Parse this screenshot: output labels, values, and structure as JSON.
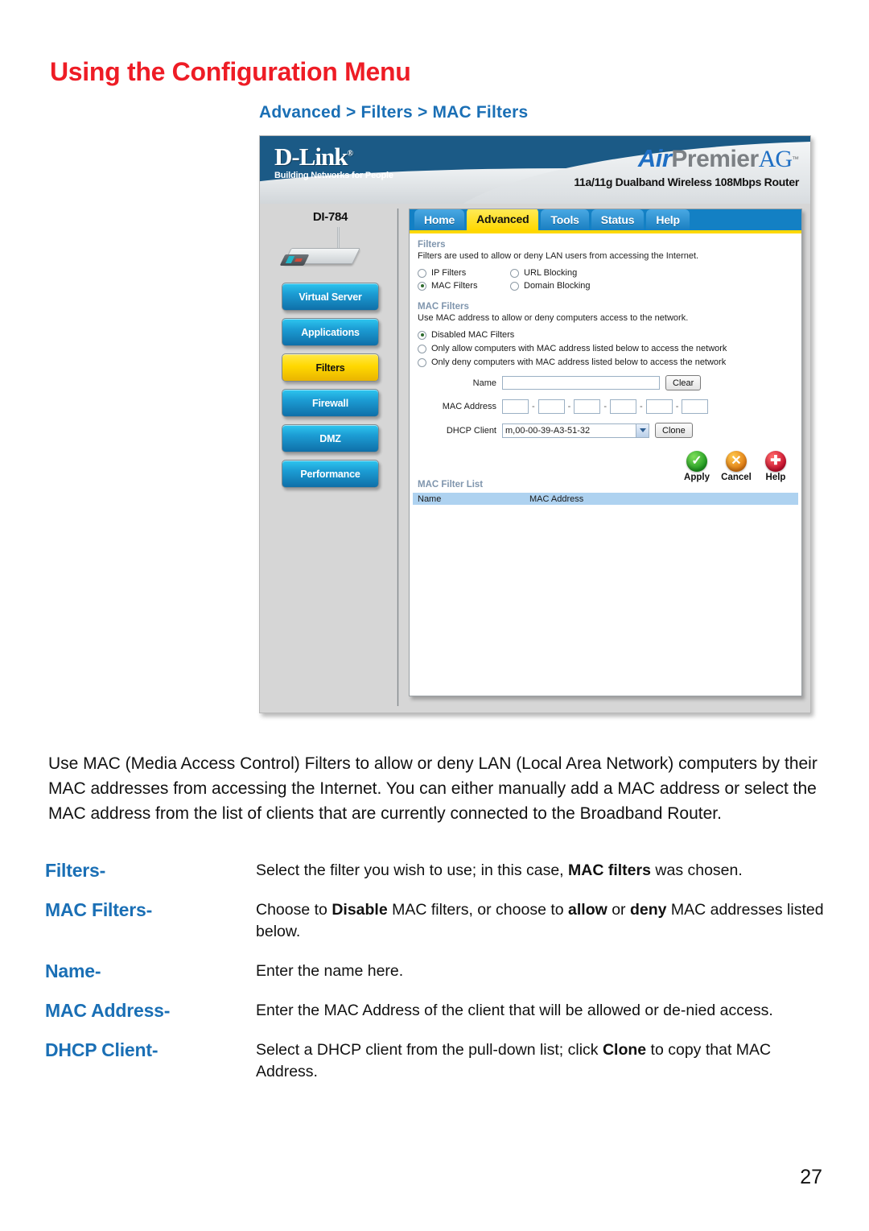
{
  "page": {
    "title": "Using the Configuration Menu",
    "breadcrumb": "Advanced > Filters > MAC Filters",
    "number": "27",
    "title_color": "#ee1c25",
    "accent_color": "#1a6fb5"
  },
  "router_ui": {
    "brand": {
      "name": "D-Link",
      "registered": "®",
      "tagline": "Building Networks for People",
      "product_air": "Air",
      "product_premier": "Premier",
      "product_ag": "AG",
      "trademark": "™",
      "subtitle": "11a/11g Dualband Wireless 108Mbps Router"
    },
    "model": "DI-784",
    "tabs": [
      {
        "label": "Home",
        "active": false
      },
      {
        "label": "Advanced",
        "active": true
      },
      {
        "label": "Tools",
        "active": false
      },
      {
        "label": "Status",
        "active": false
      },
      {
        "label": "Help",
        "active": false
      }
    ],
    "sidebar": [
      {
        "label": "Virtual Server",
        "active": false
      },
      {
        "label": "Applications",
        "active": false
      },
      {
        "label": "Filters",
        "active": true
      },
      {
        "label": "Firewall",
        "active": false
      },
      {
        "label": "DMZ",
        "active": false
      },
      {
        "label": "Performance",
        "active": false
      }
    ],
    "filters_section": {
      "title": "Filters",
      "description": "Filters are used to allow or deny LAN users from accessing the Internet.",
      "options_left": [
        {
          "label": "IP Filters",
          "selected": false
        },
        {
          "label": "MAC Filters",
          "selected": true
        }
      ],
      "options_right": [
        {
          "label": "URL Blocking",
          "selected": false
        },
        {
          "label": "Domain Blocking",
          "selected": false
        }
      ]
    },
    "mac_filters_section": {
      "title": "MAC Filters",
      "description": "Use MAC address to allow or deny computers access to the network.",
      "modes": [
        {
          "label": "Disabled MAC Filters",
          "selected": true
        },
        {
          "label": "Only allow computers with MAC address listed below to access the network",
          "selected": false
        },
        {
          "label": "Only deny computers with MAC address listed below to access the network",
          "selected": false
        }
      ],
      "name_label": "Name",
      "name_value": "",
      "clear_button": "Clear",
      "mac_label": "MAC Address",
      "mac_octets": [
        "",
        "",
        "",
        "",
        "",
        ""
      ],
      "mac_separator": "-",
      "dhcp_label": "DHCP Client",
      "dhcp_value": "m,00-00-39-A3-51-32",
      "clone_button": "Clone"
    },
    "actions": [
      {
        "label": "Apply",
        "icon": "check-circle-icon",
        "glyph": "✓"
      },
      {
        "label": "Cancel",
        "icon": "cross-circle-icon",
        "glyph": "✕"
      },
      {
        "label": "Help",
        "icon": "plus-circle-icon",
        "glyph": "✚"
      }
    ],
    "filter_list": {
      "title": "MAC Filter List",
      "columns": [
        "Name",
        "MAC Address"
      ],
      "rows": []
    }
  },
  "body": {
    "paragraph": "Use MAC (Media Access Control) Filters to allow or deny LAN (Local Area Network) computers by their MAC addresses from accessing the Internet. You can either manually add a MAC address or select the MAC address from the list of clients that are currently connected to the Broadband Router.",
    "definitions": [
      {
        "term": "Filters-",
        "parts": [
          {
            "text": "Select the filter you wish to use; in this case, ",
            "bold": false
          },
          {
            "text": "MAC filters",
            "bold": true
          },
          {
            "text": " was chosen.",
            "bold": false
          }
        ]
      },
      {
        "term": "MAC Filters-",
        "parts": [
          {
            "text": "Choose to ",
            "bold": false
          },
          {
            "text": "Disable",
            "bold": true
          },
          {
            "text": " MAC filters, or choose to ",
            "bold": false
          },
          {
            "text": "allow",
            "bold": true
          },
          {
            "text": " or ",
            "bold": false
          },
          {
            "text": "deny",
            "bold": true
          },
          {
            "text": " MAC addresses listed below.",
            "bold": false
          }
        ]
      },
      {
        "term": "Name-",
        "parts": [
          {
            "text": "Enter the name here.",
            "bold": false
          }
        ]
      },
      {
        "term": "MAC Address-",
        "parts": [
          {
            "text": "Enter the MAC Address of the client that will be allowed or de-nied access.",
            "bold": false
          }
        ]
      },
      {
        "term": "DHCP Client-",
        "parts": [
          {
            "text": "Select a DHCP client from the pull-down list; click ",
            "bold": false
          },
          {
            "text": "Clone",
            "bold": true
          },
          {
            "text": " to copy that MAC Address.",
            "bold": false
          }
        ]
      }
    ]
  }
}
